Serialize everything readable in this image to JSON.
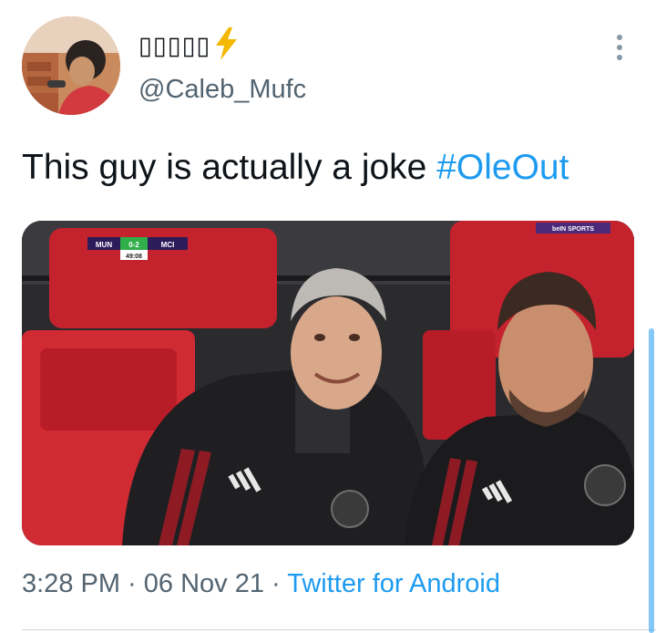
{
  "author": {
    "display_name": "▯▯▯▯▯",
    "handle": "@Caleb_Mufc",
    "avatar_icon": "avatar-photo",
    "badge_icon": "lightning-bolt-icon"
  },
  "tweet": {
    "text": "This guy is actually a joke ",
    "hashtag": "#OleOut"
  },
  "media": {
    "scoreboard": {
      "home": "MUN",
      "score": "0-2",
      "away": "MCI",
      "clock": "49:08"
    },
    "broadcaster": "beIN SPORTS",
    "kit_brand": "adidas"
  },
  "meta": {
    "time": "3:28 PM",
    "separator": " · ",
    "date": "06 Nov 21",
    "source": "Twitter for Android"
  },
  "colors": {
    "link": "#1d9bf0",
    "secondary_text": "#536471",
    "primary_text": "#0f1419",
    "bolt": "#f5b800"
  }
}
